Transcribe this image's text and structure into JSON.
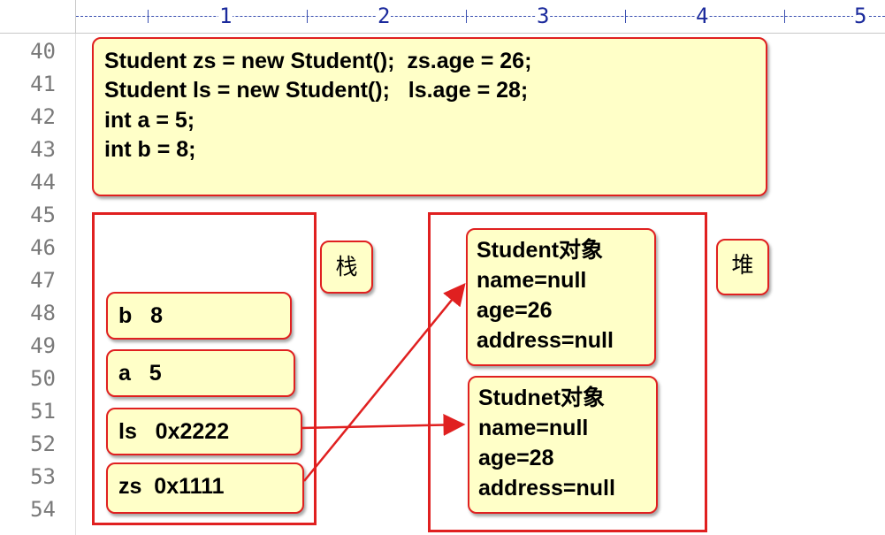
{
  "ruler": {
    "marks": [
      "1",
      "2",
      "3",
      "4",
      "5"
    ]
  },
  "line_numbers": [
    "40",
    "41",
    "42",
    "43",
    "44",
    "45",
    "46",
    "47",
    "48",
    "49",
    "50",
    "51",
    "52",
    "53",
    "54"
  ],
  "code": {
    "lines": [
      "Student zs = new Student();  zs.age = 26;",
      "Student ls = new Student();   ls.age = 28;",
      "int a = 5;",
      "int b = 8;"
    ]
  },
  "stack": {
    "label": "栈",
    "cells": [
      "b   8",
      "a   5",
      "ls   0x2222",
      "zs  0x1111"
    ]
  },
  "heap": {
    "label": "堆",
    "objects": [
      {
        "title": "Student对象",
        "fields": [
          "name=null",
          "age=26",
          "address=null"
        ]
      },
      {
        "title": "Studnet对象",
        "fields": [
          "name=null",
          "age=28",
          "address=null"
        ]
      }
    ]
  },
  "colors": {
    "accent": "#e02020",
    "note_bg": "#ffffc8",
    "ruler": "#1b2a9c"
  }
}
